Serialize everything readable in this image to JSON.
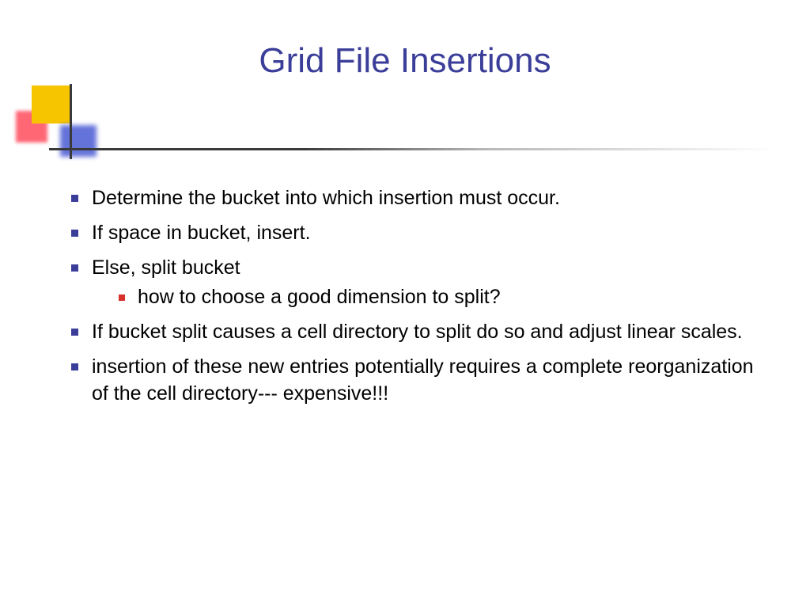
{
  "title": "Grid File Insertions",
  "bullets": {
    "b1": "Determine the bucket into which insertion must occur.",
    "b2": "If space in bucket, insert.",
    "b3": "Else, split bucket",
    "b3_sub1": "how to choose a good dimension to split?",
    "b4": "If bucket split causes a cell directory to split do so and adjust linear scales.",
    "b5": "insertion of these new entries potentially requires a complete reorganization of the cell directory--- expensive!!!"
  }
}
